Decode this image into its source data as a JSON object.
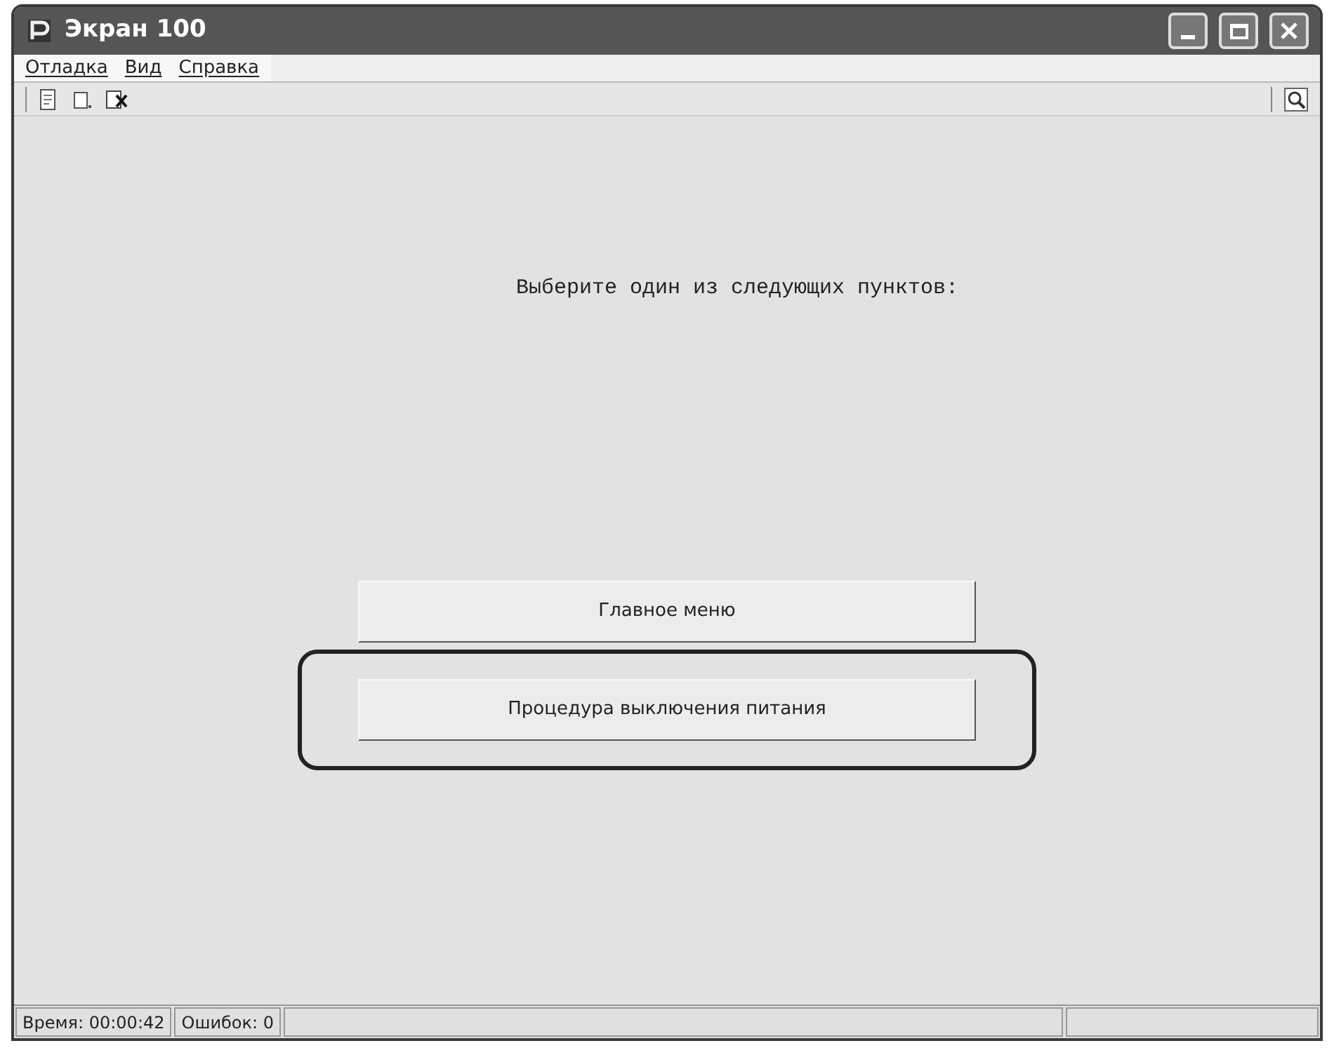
{
  "window": {
    "title": "Экран 100"
  },
  "menu": [
    "Отладка",
    "Вид",
    "Справка"
  ],
  "prompt": "Выберите один из следующих пунктов:",
  "buttons": [
    {
      "label": "Главное меню",
      "highlighted": false
    },
    {
      "label": "Процедура выключения питания",
      "highlighted": true
    }
  ],
  "status_bar": [
    "Время: 00:00:42",
    "Ошибок: 0"
  ]
}
